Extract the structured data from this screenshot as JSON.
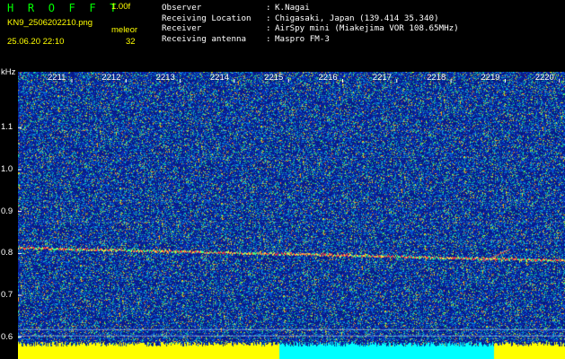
{
  "header": {
    "brand": "H R O F F T",
    "version": "1.00f",
    "filename": "KN9_2506202210.png",
    "meteor_label": "meleor",
    "datetime": "25.06.20 22:10",
    "meteor_count": "32"
  },
  "info": [
    {
      "key": "Observer",
      "sep": ":",
      "value": "K.Nagai"
    },
    {
      "key": "Receiving Location",
      "sep": ":",
      "value": "Chigasaki, Japan (139.414 35.340)"
    },
    {
      "key": "Receiver",
      "sep": ":",
      "value": "AirSpy mini (Miakejima VOR 108.65MHz)"
    },
    {
      "key": "Receiving antenna",
      "sep": ":",
      "value": "Maspro FM-3"
    }
  ],
  "axis": {
    "unit": "kHz",
    "freq_ticks": [
      "1.1",
      "1.0",
      "0.9",
      "0.8",
      "0.7",
      "0.6"
    ],
    "freq_range": [
      0.58,
      1.18
    ],
    "time_ticks": [
      "2211",
      "2212",
      "2213",
      "2214",
      "2215",
      "2216",
      "2217",
      "2218",
      "2219",
      "2220"
    ]
  },
  "colors": {
    "background": "#000000",
    "brand": "#00ff00",
    "header_text": "#ffff00",
    "info_text": "#ffffff",
    "spectrum_base": "#0a1a8a",
    "trace": "#ff4040",
    "power_low": "#ffff00",
    "power_high": "#00ffff"
  }
}
